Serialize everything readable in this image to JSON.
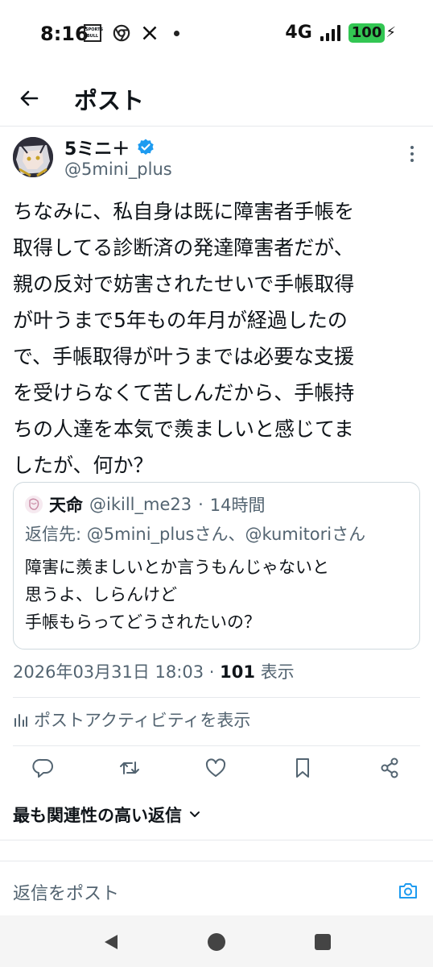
{
  "status_bar": {
    "time": "8:16",
    "sportsbull_icon_text": "SPORTS BULL",
    "network": "4G",
    "battery": "100",
    "icons": [
      "sportsbull-icon",
      "chrome-icon",
      "x-icon",
      "notification-dot-icon",
      "signal-icon",
      "battery-icon"
    ]
  },
  "header": {
    "title": "ポスト",
    "back_icon": "arrow-left-icon"
  },
  "post": {
    "author_name": "5ミニ＋",
    "author_handle": "@5mini_plus",
    "verified": true,
    "text": "ちなみに、私自身は既に障害者手帳を\n取得してる診断済の発達障害者だが、\n親の反対で妨害されたせいで手帳取得\nが叶うまで5年もの年月が経過したの\nで、手帳取得が叶うまでは必要な支援\nを受けらなくて苦しんだから、手帳持\nちの人達を本気で羨ましいと感じてま\nしたが、何か？",
    "timestamp": "2026年03月31日 18:03",
    "separator": "·",
    "views_count": "101",
    "views_label": "表示"
  },
  "quote": {
    "author_name": "天命",
    "author_handle": "@ikill_me23",
    "separator": "·",
    "time_ago": "14時間",
    "reply_to": "返信先: @5mini_plusさん、@kumitoriさん",
    "text": "障害に羨ましいとか言うもんじゃないと\n思うよ、しらんけど\n手帳もらってどうされたいの？"
  },
  "activity": {
    "label": "ポストアクティビティを表示"
  },
  "actions": [
    "reply-icon",
    "repost-icon",
    "like-icon",
    "bookmark-icon",
    "share-icon"
  ],
  "sort": {
    "label": "最も関連性の高い返信"
  },
  "reply_bar": {
    "placeholder": "返信をポスト"
  },
  "colors": {
    "primary_text": "#0f1419",
    "secondary_text": "#536471",
    "accent": "#1d9bf0",
    "battery": "#33c653",
    "border": "#cfd9de"
  }
}
